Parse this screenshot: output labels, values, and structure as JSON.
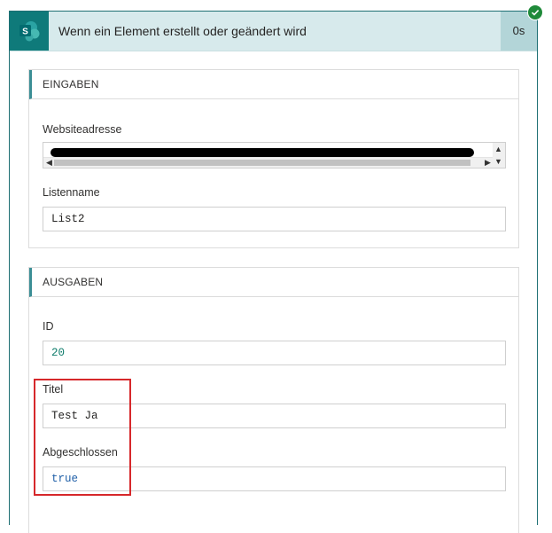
{
  "header": {
    "icon": "sharepoint-icon",
    "title": "Wenn ein Element erstellt oder geändert wird",
    "duration": "0s",
    "status_icon": "success-check-icon",
    "status_color": "#1f8a3a"
  },
  "inputs": {
    "section_title": "EINGABEN",
    "website_label": "Websiteadresse",
    "list_label": "Listenname",
    "list_value": "List2"
  },
  "outputs": {
    "section_title": "AUSGABEN",
    "id_label": "ID",
    "id_value": "20",
    "title_label": "Titel",
    "title_value": "Test Ja",
    "completed_label": "Abgeschlossen",
    "completed_value": "true"
  },
  "colors": {
    "accent": "#0f7a7a",
    "header_bg": "#d7eaec",
    "highlight": "#d6282b"
  }
}
